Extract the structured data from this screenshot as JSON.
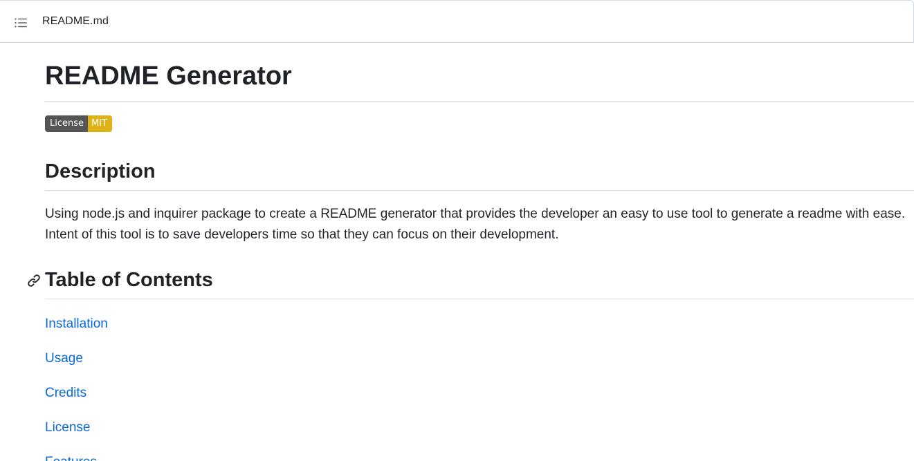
{
  "header": {
    "file_name": "README.md",
    "outline_icon": "list-unordered-icon"
  },
  "readme": {
    "title": "README Generator",
    "badge": {
      "label": "License",
      "value": "MIT",
      "label_color": "#555555",
      "value_color": "#dfb317"
    },
    "description": {
      "heading": "Description",
      "text": "Using node.js and inquirer package to create a README generator that provides the developer an easy to use tool to generate a readme with ease. Intent of this tool is to save developers time so that they can focus on their development."
    },
    "toc": {
      "heading": "Table of Contents",
      "anchor_icon": "link-icon",
      "items": [
        "Installation",
        "Usage",
        "Credits",
        "License",
        "Features"
      ]
    }
  },
  "colors": {
    "text": "#1f2328",
    "link": "#0969da",
    "border": "#d1d9e0"
  }
}
